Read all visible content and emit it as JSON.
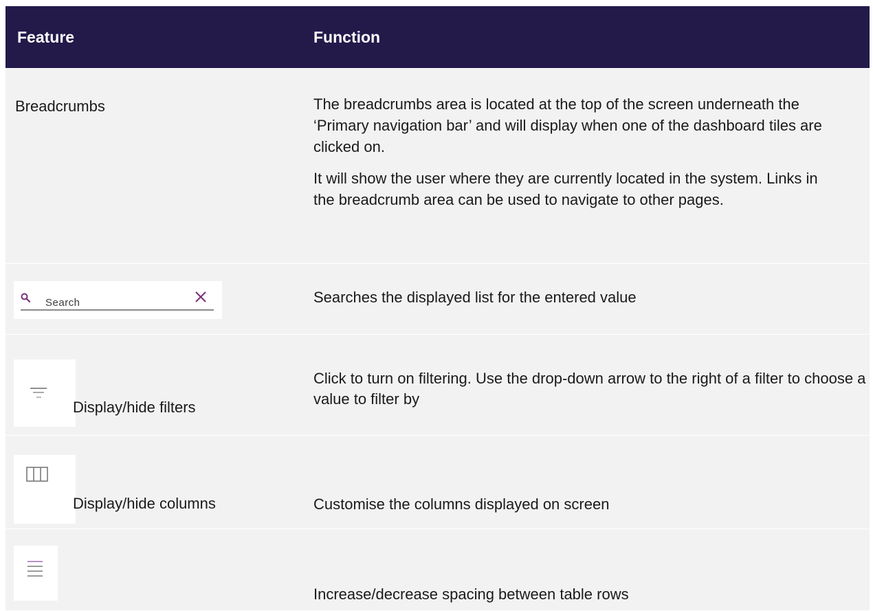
{
  "table": {
    "headers": {
      "feature": "Feature",
      "function": "Function"
    },
    "rows": [
      {
        "feature": "Breadcrumbs",
        "function_paragraphs": [
          "The breadcrumbs area is located at the top of the screen underneath the ‘Primary navigation bar’ and will display when one of the dashboard tiles are clicked on.",
          "It will show the user where they are currently located in the system. Links in the breadcrumb area can be used to navigate to other pages."
        ]
      },
      {
        "feature_search_placeholder": "Search",
        "feature_icons": [
          "search-icon",
          "close-icon"
        ],
        "function": "Searches the displayed list for the entered value"
      },
      {
        "feature": "Display/hide filters",
        "feature_icon": "filter-icon",
        "function": "Click to turn on filtering. Use the drop-down arrow to the right of a filter to choose a value to filter by"
      },
      {
        "feature": "Display/hide columns",
        "feature_icon": "columns-icon",
        "function": "Customise the columns displayed on screen"
      },
      {
        "feature_icon": "row-density-icon",
        "function": "Increase/decrease spacing between table rows"
      }
    ]
  },
  "colors": {
    "header_bg": "#231a4a",
    "row_bg": "#f2f2f2",
    "accent": "#7a2e7a"
  }
}
